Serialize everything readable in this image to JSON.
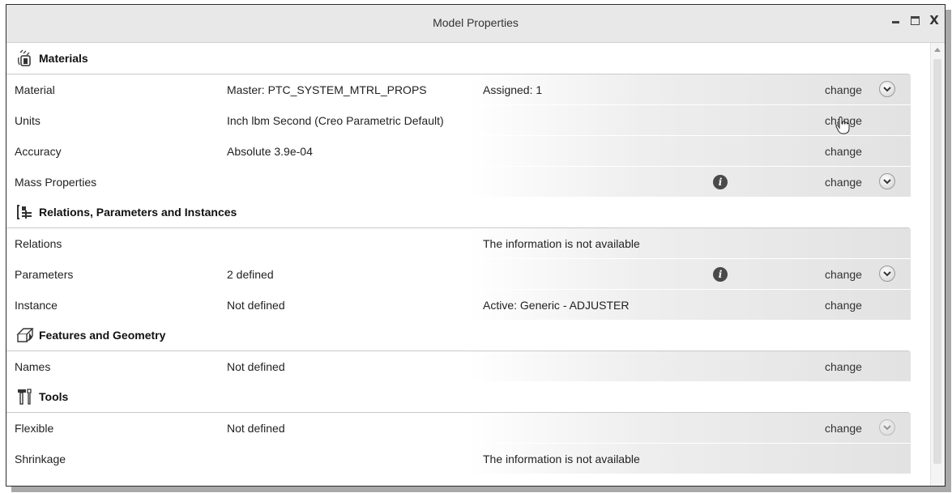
{
  "window": {
    "title": "Model Properties"
  },
  "sections": {
    "materials": {
      "title": "Materials",
      "rows": {
        "material": {
          "label": "Material",
          "value": "Master: PTC_SYSTEM_MTRL_PROPS",
          "extra": "Assigned: 1",
          "action": "change"
        },
        "units": {
          "label": "Units",
          "value": "Inch lbm Second (Creo Parametric Default)",
          "action": "change"
        },
        "accuracy": {
          "label": "Accuracy",
          "value": "Absolute 3.9e-04",
          "action": "change"
        },
        "mass": {
          "label": "Mass Properties",
          "action": "change"
        }
      }
    },
    "relations": {
      "title": "Relations, Parameters and Instances",
      "rows": {
        "relations": {
          "label": "Relations",
          "extra": "The information is not available"
        },
        "parameters": {
          "label": "Parameters",
          "value": "2 defined",
          "action": "change"
        },
        "instance": {
          "label": "Instance",
          "value": "Not defined",
          "extra": "Active: Generic - ADJUSTER",
          "action": "change"
        }
      }
    },
    "features": {
      "title": "Features and Geometry",
      "rows": {
        "names": {
          "label": "Names",
          "value": "Not defined",
          "action": "change"
        }
      }
    },
    "tools": {
      "title": "Tools",
      "rows": {
        "flexible": {
          "label": "Flexible",
          "value": "Not defined",
          "action": "change"
        },
        "shrinkage": {
          "label": "Shrinkage",
          "extra": "The information is not available"
        }
      }
    }
  },
  "icons": {
    "materials": "materials-icon",
    "relations": "relations-icon",
    "features": "features-geometry-icon",
    "tools": "tools-icon",
    "info": "info-icon",
    "expand": "chevron-down-icon",
    "cursor": "hand-cursor-icon"
  }
}
